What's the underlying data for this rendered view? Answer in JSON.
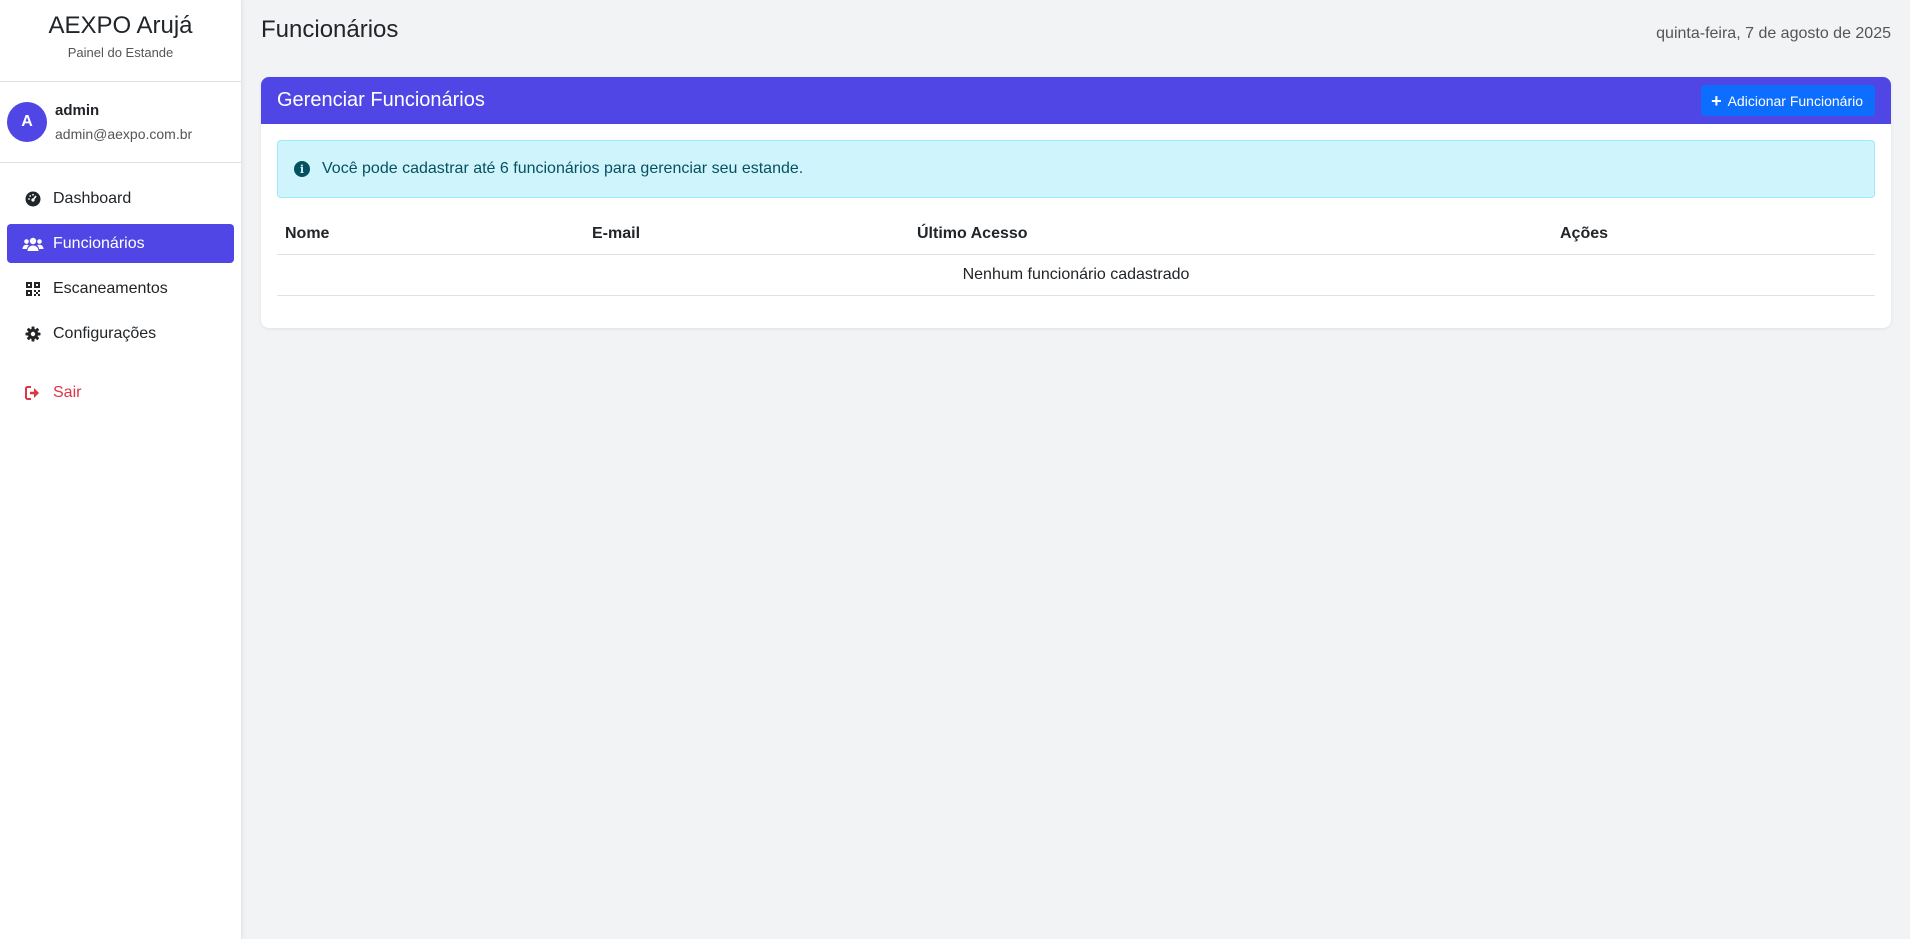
{
  "sidebar": {
    "brand_title": "AEXPO Arujá",
    "brand_subtitle": "Painel do Estande",
    "user": {
      "avatar_letter": "A",
      "name": "admin",
      "email": "admin@aexpo.com.br"
    },
    "nav": [
      {
        "label": "Dashboard",
        "icon": "gauge-icon",
        "active": false
      },
      {
        "label": "Funcionários",
        "icon": "users-icon",
        "active": true
      },
      {
        "label": "Escaneamentos",
        "icon": "qrcode-icon",
        "active": false
      },
      {
        "label": "Configurações",
        "icon": "gear-icon",
        "active": false
      }
    ],
    "logout": {
      "label": "Sair",
      "icon": "sign-out-icon"
    }
  },
  "header": {
    "title": "Funcionários",
    "date": "quinta-feira, 7 de agosto de 2025"
  },
  "card": {
    "title": "Gerenciar Funcionários",
    "add_button": "Adicionar Funcionário",
    "alert": "Você pode cadastrar até 6 funcionários para gerenciar seu estande.",
    "table": {
      "columns": [
        "Nome",
        "E-mail",
        "Último Acesso",
        "Ações"
      ],
      "empty_message": "Nenhum funcionário cadastrado"
    }
  },
  "colors": {
    "primary": "#4f46e5",
    "button_blue": "#0d6efd",
    "alert_bg": "#cff4fc",
    "alert_text": "#055160",
    "danger": "#dc3545"
  }
}
